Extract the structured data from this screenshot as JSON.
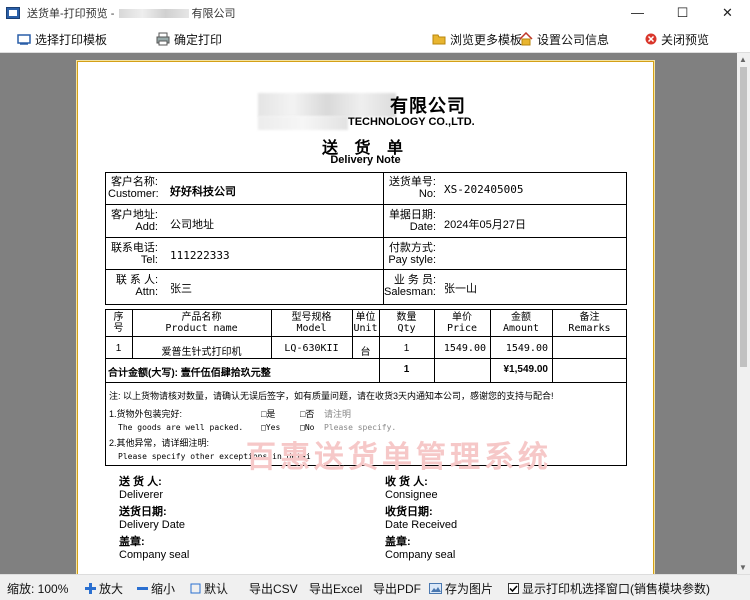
{
  "window": {
    "title_prefix": "送货单-打印预览 - ",
    "title_suffix": "有限公司",
    "minimize": "—",
    "maximize": "☐",
    "close": "✕"
  },
  "toolbar": {
    "select_template": "选择打印模板",
    "confirm_print": "确定打印",
    "browse_templates": "浏览更多模板",
    "company_info": "设置公司信息",
    "close_preview": "关闭预览"
  },
  "document": {
    "company_cn": "有限公司",
    "company_en": "TECHNOLOGY CO.,LTD.",
    "title_cn": "送 货 单",
    "title_en": "Delivery Note",
    "info": {
      "customer_label": "客户名称:",
      "customer_label_en": "Customer:",
      "customer": "好好科技公司",
      "address_label": "客户地址:",
      "address_label_en": "Add:",
      "address": "公司地址",
      "tel_label": "联系电话:",
      "tel_label_en": "Tel:",
      "tel": "111222333",
      "attn_label": "联 系 人:",
      "attn_label_en": "Attn:",
      "attn": "张三",
      "no_label": "送货单号:",
      "no_label_en": "No:",
      "no": "XS-202405005",
      "date_label": "单据日期:",
      "date_label_en": "Date:",
      "date": "2024年05月27日",
      "pay_label": "付款方式:",
      "pay_label_en": "Pay style:",
      "pay": "",
      "sales_label": "业 务 员:",
      "sales_label_en": "Salesman:",
      "sales": "张一山"
    },
    "table": {
      "headers": [
        {
          "cn": "序",
          "en": "号"
        },
        {
          "cn": "产品名称",
          "en": "Product name"
        },
        {
          "cn": "型号规格",
          "en": "Model"
        },
        {
          "cn": "单位",
          "en": "Unit"
        },
        {
          "cn": "数量",
          "en": "Qty"
        },
        {
          "cn": "单价",
          "en": "Price"
        },
        {
          "cn": "金额",
          "en": "Amount"
        },
        {
          "cn": "备注",
          "en": "Remarks"
        }
      ],
      "rows": [
        [
          "1",
          "爱普生针式打印机",
          "LQ-630KII",
          "台",
          "1",
          "1549.00",
          "1549.00",
          ""
        ]
      ],
      "total_label": "合计金额(大写): 壹仟伍佰肆拾玖元整",
      "total_qty": "1",
      "total_amount": "¥1,549.00"
    },
    "notes": {
      "line1": "注: 以上货物请核对数量，请确认无误后签字，如有质量问题，请在收货3天内通知本公司，感谢您的支持与配合!",
      "q1_label": "1.货物外包装完好:",
      "q1_yes": "□是",
      "q1_no": "□否",
      "q1_hint": "请注明",
      "q1_en": "The goods are well packed.",
      "q1_yes_en": "□Yes",
      "q1_no_en": "□No",
      "q1_hint_en": "Please specify.",
      "q2_label": "2.其他异常，请详细注明:",
      "q2_en": "Please specify other exceptions in detai"
    },
    "watermark": "百惠送货单管理系统",
    "signatures": {
      "deliverer_cn": "送 货 人:",
      "deliverer_en": "Deliverer",
      "consignee_cn": "收 货 人:",
      "consignee_en": "Consignee",
      "delivery_date_cn": "送货日期:",
      "delivery_date_en": "Delivery Date",
      "received_date_cn": "收货日期:",
      "received_date_en": "Date Received",
      "seal_cn": "盖章:",
      "seal_en": "Company seal",
      "seal2_cn": "盖章:",
      "seal2_en": "Company seal"
    }
  },
  "statusbar": {
    "zoom_label": "缩放: 100%",
    "zoom_in": "放大",
    "zoom_out": "缩小",
    "default": "默认",
    "export_csv": "导出CSV",
    "export_excel": "导出Excel",
    "export_pdf": "导出PDF",
    "save_image": "存为图片",
    "show_printer": "显示打印机选择窗口(销售模块参数)"
  },
  "colors": {
    "watermark": "#f6c8c8",
    "paper_border": "#d4a017",
    "preview_bg": "#808080"
  }
}
